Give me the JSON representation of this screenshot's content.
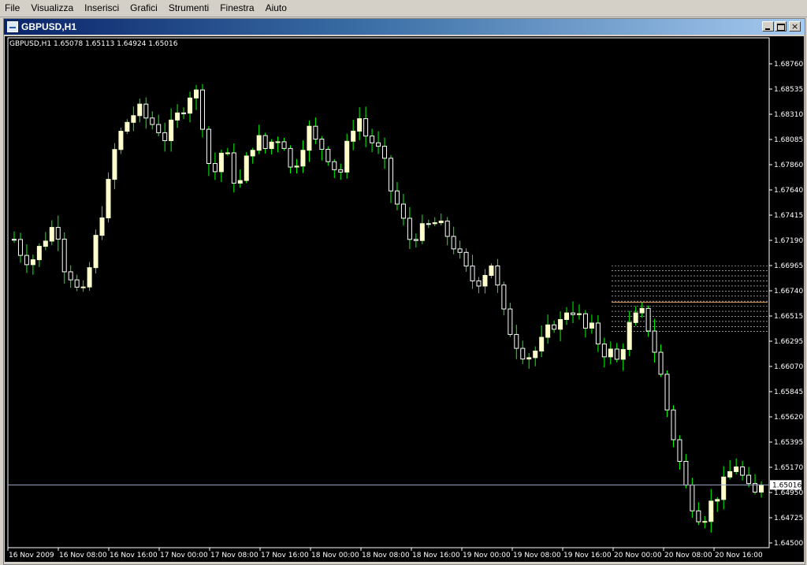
{
  "menu": [
    "File",
    "Visualizza",
    "Inserisci",
    "Grafici",
    "Strumenti",
    "Finestra",
    "Aiuto"
  ],
  "window": {
    "title": "GBPUSD,H1"
  },
  "chart_info": "GBPUSD,H1  1.65078 1.65113 1.64924 1.65016",
  "colors": {
    "background": "#000000",
    "bull": "#ffffcc",
    "bear": "#ffffff",
    "wick": "#00ff00",
    "axis": "#ffffff",
    "bid_line": "#9fa9c0",
    "level_dotted": "#e8e8e8",
    "level_main": "#e8a86a"
  },
  "current_price_label": "1.65016",
  "chart_data": {
    "type": "candlestick",
    "symbol": "GBPUSD",
    "timeframe": "H1",
    "y_ticks": [
      "1.68760",
      "1.68535",
      "1.68310",
      "1.68085",
      "1.67860",
      "1.67640",
      "1.67415",
      "1.67190",
      "1.66965",
      "1.66740",
      "1.66515",
      "1.66295",
      "1.66070",
      "1.65845",
      "1.65620",
      "1.65395",
      "1.65170",
      "1.64950",
      "1.64725",
      "1.64500"
    ],
    "x_ticks": [
      "16 Nov 2009",
      "16 Nov 08:00",
      "16 Nov 16:00",
      "17 Nov 00:00",
      "17 Nov 08:00",
      "17 Nov 16:00",
      "18 Nov 00:00",
      "18 Nov 08:00",
      "18 Nov 16:00",
      "19 Nov 00:00",
      "19 Nov 08:00",
      "19 Nov 16:00",
      "20 Nov 00:00",
      "20 Nov 08:00",
      "20 Nov 16:00"
    ],
    "last_bar": {
      "open": 1.65078,
      "high": 1.65113,
      "low": 1.64924,
      "close": 1.65016
    },
    "bid": 1.65016,
    "price_range": [
      1.645,
      1.6895
    ],
    "bars_visible": 120,
    "close_path": [
      1.672,
      1.6705,
      1.67,
      1.6712,
      1.6725,
      1.6735,
      1.6695,
      1.6685,
      1.6665,
      1.6695,
      1.673,
      1.676,
      1.68,
      1.682,
      1.683,
      1.6835,
      1.6825,
      1.682,
      1.681,
      1.6825,
      1.6835,
      1.685,
      1.685,
      1.679,
      1.678,
      1.6805,
      1.6775,
      1.677,
      1.68,
      1.681,
      1.68,
      1.681,
      1.681,
      1.678,
      1.6795,
      1.682,
      1.6805,
      1.68,
      1.6785,
      1.678,
      1.6815,
      1.683,
      1.681,
      1.6805,
      1.679,
      1.676,
      1.6745,
      1.672,
      1.6725,
      1.673,
      1.6735,
      1.673,
      1.672,
      1.6705,
      1.669,
      1.668,
      1.669,
      1.67,
      1.666,
      1.664,
      1.6625,
      1.6615,
      1.662,
      1.663,
      1.6645,
      1.6645,
      1.666,
      1.6655,
      1.664,
      1.664,
      1.662,
      1.662,
      1.661,
      1.664,
      1.665,
      1.6655,
      1.663,
      1.66,
      1.656,
      1.653,
      1.65,
      1.648,
      1.647,
      1.6485,
      1.6495,
      1.651,
      1.652,
      1.6505,
      1.649,
      1.6502
    ]
  }
}
